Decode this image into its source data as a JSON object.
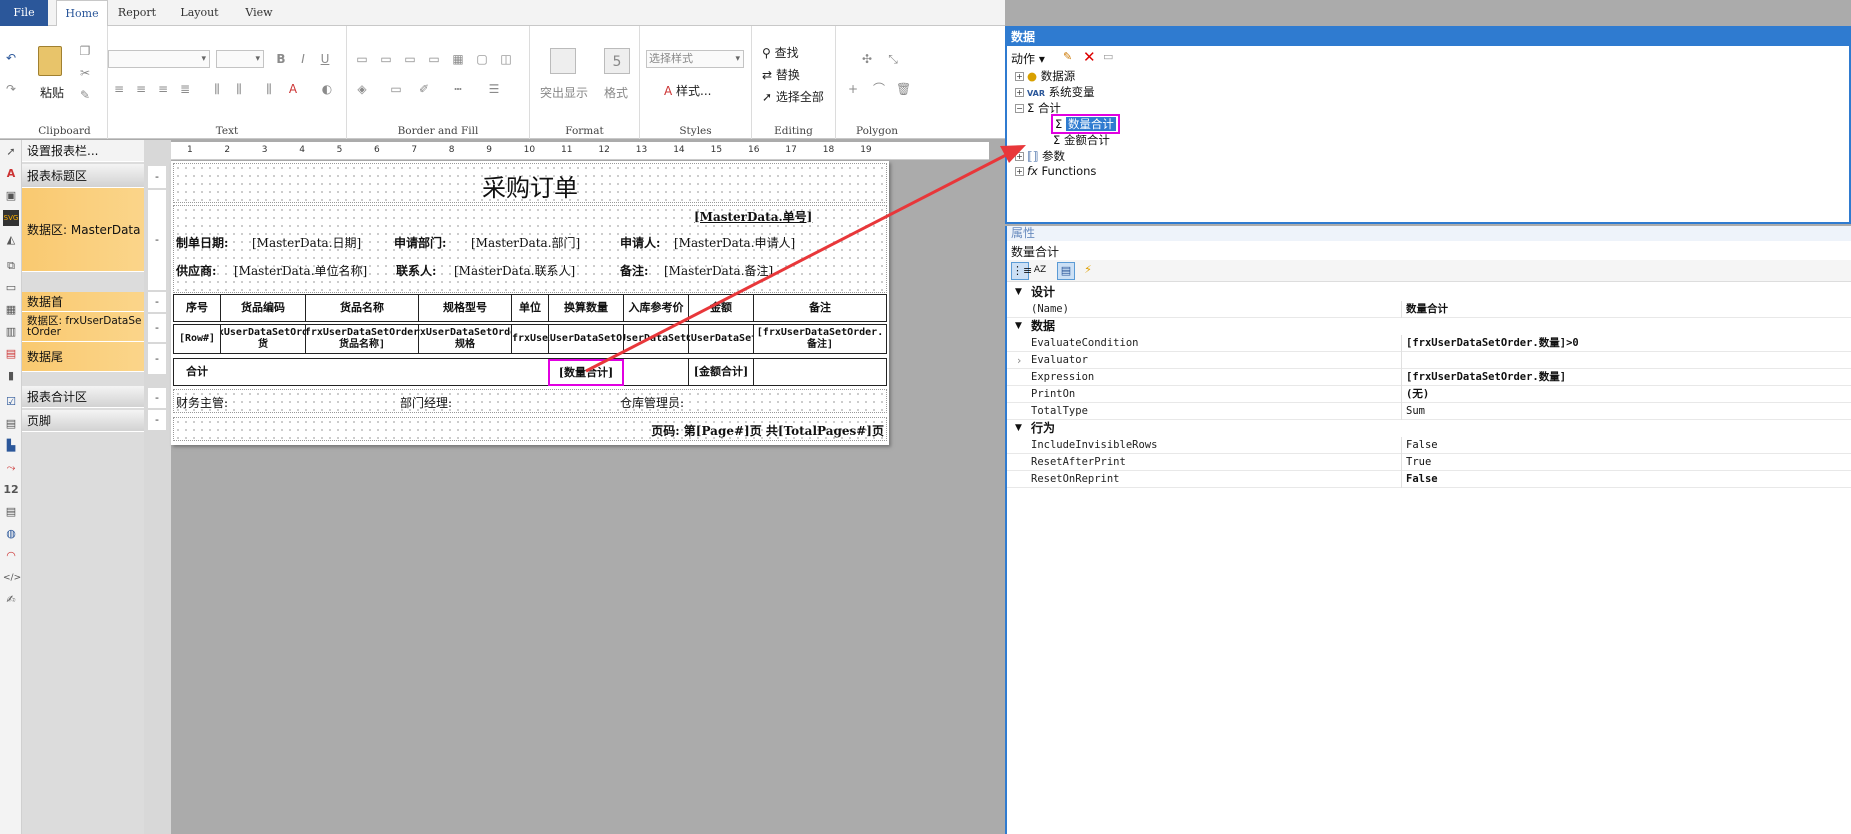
{
  "ribbon": {
    "tabs": [
      "File",
      "Home",
      "Report",
      "Layout",
      "View"
    ],
    "groups": [
      "Clipboard",
      "Text",
      "Border and Fill",
      "Format",
      "Styles",
      "Editing",
      "Polygon"
    ],
    "paste": "粘贴",
    "highlight": "突出显示",
    "format": "格式",
    "style_combo": "选择样式",
    "styles_btn": "样式...",
    "find": "查找",
    "replace": "替换",
    "select_all": "选择全部"
  },
  "band_panel": {
    "header": "设置报表栏...",
    "bands": [
      "报表标题区",
      "数据区: MasterData",
      "数据首",
      "数据区: frxUserDataSetOrder",
      "数据尾",
      "报表合计区",
      "页脚"
    ]
  },
  "ruler": [
    "1",
    "2",
    "3",
    "4",
    "5",
    "6",
    "7",
    "8",
    "9",
    "10",
    "11",
    "12",
    "13",
    "14",
    "15",
    "16",
    "17",
    "18",
    "19"
  ],
  "report": {
    "title": "采购订单",
    "order_no": "[MasterData.单号]",
    "date_label": "制单日期:",
    "date_val": "[MasterData.日期]",
    "dept_label": "申请部门:",
    "dept_val": "[MasterData.部门]",
    "applicant_label": "申请人:",
    "applicant_val": "[MasterData.申请人]",
    "supplier_label": "供应商:",
    "supplier_val": "[MasterData.单位名称]",
    "contact_label": "联系人:",
    "contact_val": "[MasterData.联系人]",
    "remark_label": "备注:",
    "remark_val": "[MasterData.备注]",
    "headers": [
      "序号",
      "货品编码",
      "货品名称",
      "规格型号",
      "单位",
      "换算数量",
      "入库参考价",
      "金额",
      "备注"
    ],
    "datarow": [
      "[Row#]",
      "[frxUserDataSetOrder.货",
      "[frxUserDataSetOrder.货品名称]",
      "[frxUserDataSetOrder.规格",
      "[frxUser",
      "[frxUserDataSetOrder",
      "[frxUserDataSetOrder",
      "[frxUserDataSetOrd",
      "[frxUserDataSetOrder.备注]"
    ],
    "total_label": "合计",
    "total_qty": "[数量合计]",
    "total_amt": "[金额合计]",
    "finance": "财务主管:",
    "manager": "部门经理:",
    "warehouse": "仓库管理员:",
    "footer": "页码: 第[Page#]页 共[TotalPages#]页"
  },
  "data_panel": {
    "title": "数据",
    "action": "动作",
    "tree": [
      "数据源",
      "系统变量",
      "合计",
      "数量合计",
      "金额合计",
      "参数",
      "Functions"
    ]
  },
  "props": {
    "title": "属性",
    "object": "数量合计",
    "categories": [
      "设计",
      "数据",
      "行为"
    ],
    "rows": [
      {
        "name": "(Name)",
        "value": "数量合计"
      },
      {
        "name": "EvaluateCondition",
        "value": "[frxUserDataSetOrder.数量]>0"
      },
      {
        "name": "Evaluator",
        "value": ""
      },
      {
        "name": "Expression",
        "value": "[frxUserDataSetOrder.数量]"
      },
      {
        "name": "PrintOn",
        "value": "(无)"
      },
      {
        "name": "TotalType",
        "value": "Sum"
      },
      {
        "name": "IncludeInvisibleRows",
        "value": "False"
      },
      {
        "name": "ResetAfterPrint",
        "value": "True"
      },
      {
        "name": "ResetOnReprint",
        "value": "False"
      }
    ]
  },
  "colors": {
    "accent": "#2b579a",
    "panel_blue": "#2f7bd0",
    "highlight": "#e100e1",
    "arrow": "#e8373a",
    "band_orange": "#f9c970"
  }
}
